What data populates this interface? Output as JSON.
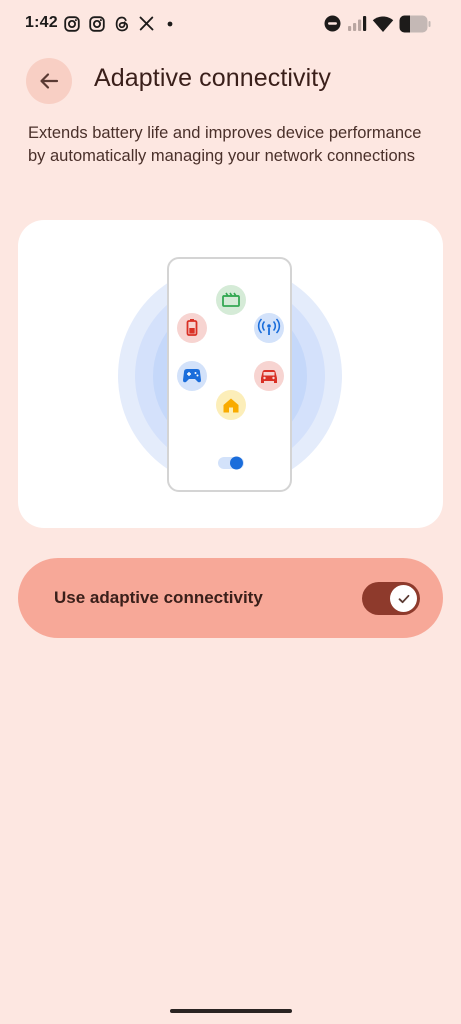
{
  "status_bar": {
    "time": "1:42",
    "notification_icons": [
      "instagram-icon",
      "instagram-icon",
      "threads-icon",
      "x-icon",
      "dot-icon"
    ],
    "system_icons": [
      "do-not-disturb-icon",
      "signal-icon",
      "wifi-icon",
      "battery-icon"
    ]
  },
  "header": {
    "back_icon": "arrow-left-icon",
    "title": "Adaptive connectivity"
  },
  "description": "Extends battery life and improves device performance by automatically managing your network connections",
  "illustration": {
    "app_icons": [
      "clapperboard-icon",
      "battery-icon",
      "antenna-icon",
      "gamepad-icon",
      "car-icon",
      "home-icon"
    ],
    "colors": {
      "ring_outer": "#E3ECFB",
      "ring_middle": "#D2E1FB",
      "ring_inner": "#C2D6FA",
      "phone_border": "#D7D7D7",
      "green": "#D6EBD8",
      "red": "#F6D3D0",
      "blue": "#D3E2FA",
      "yellow": "#FBEDB8",
      "accent_blue": "#1A6DDB"
    }
  },
  "setting": {
    "label": "Use adaptive connectivity",
    "enabled": true
  },
  "colors": {
    "background": "#FDE7E1",
    "back_button": "#F8CFC4",
    "toggle_card": "#F7A898",
    "switch_track": "#8E3A2C"
  }
}
